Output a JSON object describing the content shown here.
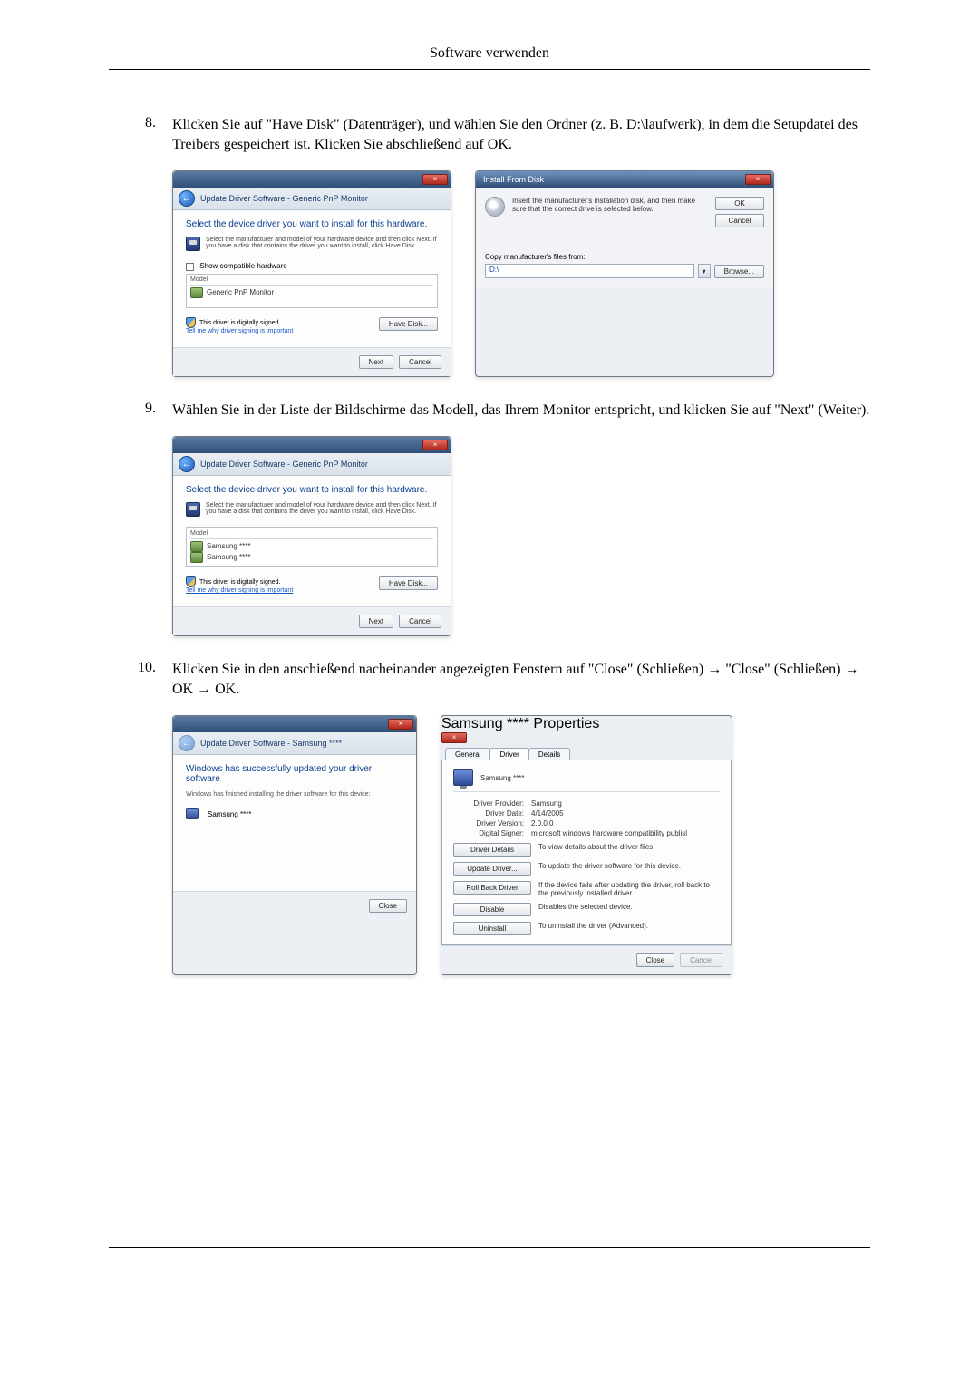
{
  "page_header": "Software verwenden",
  "steps": [
    {
      "num": "8.",
      "text": "Klicken Sie auf \"Have Disk\" (Datenträger), und wählen Sie den Ordner (z. B. D:\\laufwerk), in dem die Setupdatei des Treibers gespeichert ist. Klicken Sie abschließend auf OK."
    },
    {
      "num": "9.",
      "text": "Wählen Sie in der Liste der Bildschirme das Modell, das Ihrem Monitor entspricht, und klicken Sie auf \"Next\" (Weiter)."
    },
    {
      "num": "10.",
      "text": "Klicken Sie in den anschießend nacheinander angezeigten Fenstern auf \"Close\" (Schließen) → \"Close\" (Schließen) → OK → OK."
    }
  ],
  "dlg1": {
    "crumb": "Update Driver Software - Generic PnP Monitor",
    "heading": "Select the device driver you want to install for this hardware.",
    "subtext": "Select the manufacturer and model of your hardware device and then click Next. If you have a disk that contains the driver you want to install, click Have Disk.",
    "show_compat": "Show compatible hardware",
    "model_header": "Model",
    "model_item": "Generic PnP Monitor",
    "signed": "This driver is digitally signed.",
    "tell": "Tell me why driver signing is important",
    "have_disk": "Have Disk...",
    "next": "Next",
    "cancel": "Cancel"
  },
  "dlg_ifd": {
    "title": "Install From Disk",
    "text": "Insert the manufacturer's installation disk, and then make sure that the correct drive is selected below.",
    "ok": "OK",
    "cancel": "Cancel",
    "copy_label": "Copy manufacturer's files from:",
    "path": "D:\\",
    "browse": "Browse..."
  },
  "dlg2": {
    "crumb": "Update Driver Software - Generic PnP Monitor",
    "heading": "Select the device driver you want to install for this hardware.",
    "subtext": "Select the manufacturer and model of your hardware device and then click Next. If you have a disk that contains the driver you want to install, click Have Disk.",
    "model_header": "Model",
    "model_item1": "Samsung ****",
    "model_item2": "Samsung ****",
    "signed": "This driver is digitally signed.",
    "tell": "Tell me why driver signing is important",
    "have_disk": "Have Disk...",
    "next": "Next",
    "cancel": "Cancel"
  },
  "dlg3": {
    "crumb": "Update Driver Software - Samsung ****",
    "heading": "Windows has successfully updated your driver software",
    "subtext": "Windows has finished installing the driver software for this device:",
    "device": "Samsung ****",
    "close": "Close"
  },
  "dlg_props": {
    "title": "Samsung **** Properties",
    "tab_general": "General",
    "tab_driver": "Driver",
    "tab_details": "Details",
    "device": "Samsung ****",
    "provider_k": "Driver Provider:",
    "provider_v": "Samsung",
    "date_k": "Driver Date:",
    "date_v": "4/14/2005",
    "version_k": "Driver Version:",
    "version_v": "2.0.0.0",
    "signer_k": "Digital Signer:",
    "signer_v": "microsoft windows hardware compatibility publisl",
    "btn_details": "Driver Details",
    "btn_details_d": "To view details about the driver files.",
    "btn_update": "Update Driver...",
    "btn_update_d": "To update the driver software for this device.",
    "btn_rollback": "Roll Back Driver",
    "btn_rollback_d": "If the device fails after updating the driver, roll back to the previously installed driver.",
    "btn_disable": "Disable",
    "btn_disable_d": "Disables the selected device.",
    "btn_uninstall": "Uninstall",
    "btn_uninstall_d": "To uninstall the driver (Advanced).",
    "close": "Close",
    "cancel": "Cancel"
  }
}
